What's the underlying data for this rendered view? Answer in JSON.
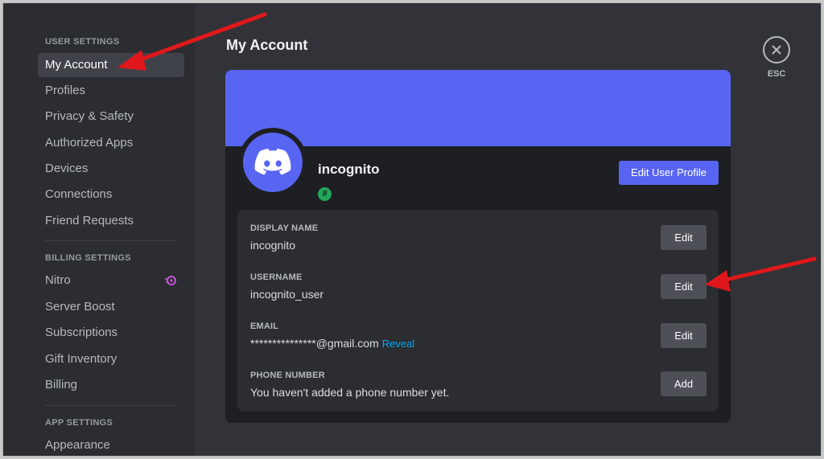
{
  "sidebar": {
    "user_settings_header": "USER SETTINGS",
    "user_items": [
      {
        "label": "My Account"
      },
      {
        "label": "Profiles"
      },
      {
        "label": "Privacy & Safety"
      },
      {
        "label": "Authorized Apps"
      },
      {
        "label": "Devices"
      },
      {
        "label": "Connections"
      },
      {
        "label": "Friend Requests"
      }
    ],
    "billing_settings_header": "BILLING SETTINGS",
    "billing_items": [
      {
        "label": "Nitro"
      },
      {
        "label": "Server Boost"
      },
      {
        "label": "Subscriptions"
      },
      {
        "label": "Gift Inventory"
      },
      {
        "label": "Billing"
      }
    ],
    "app_settings_header": "APP SETTINGS",
    "app_items": [
      {
        "label": "Appearance"
      }
    ]
  },
  "main": {
    "page_title": "My Account",
    "profile": {
      "display_username": "incognito",
      "badge_symbol": "#",
      "edit_profile_label": "Edit User Profile"
    },
    "fields": {
      "display_name": {
        "label": "DISPLAY NAME",
        "value": "incognito",
        "button": "Edit"
      },
      "username": {
        "label": "USERNAME",
        "value": "incognito_user",
        "button": "Edit"
      },
      "email": {
        "label": "EMAIL",
        "value": "***************@gmail.com",
        "reveal": "Reveal",
        "button": "Edit"
      },
      "phone": {
        "label": "PHONE NUMBER",
        "value": "You haven't added a phone number yet.",
        "button": "Add"
      }
    },
    "close": {
      "esc_label": "ESC"
    }
  },
  "colors": {
    "accent": "#5865f2",
    "sidebar_bg": "#2b2d31",
    "content_bg": "#313338",
    "annotation_arrow": "#e0181b",
    "badge_green": "#23a55a",
    "link_blue": "#00a8fc"
  }
}
